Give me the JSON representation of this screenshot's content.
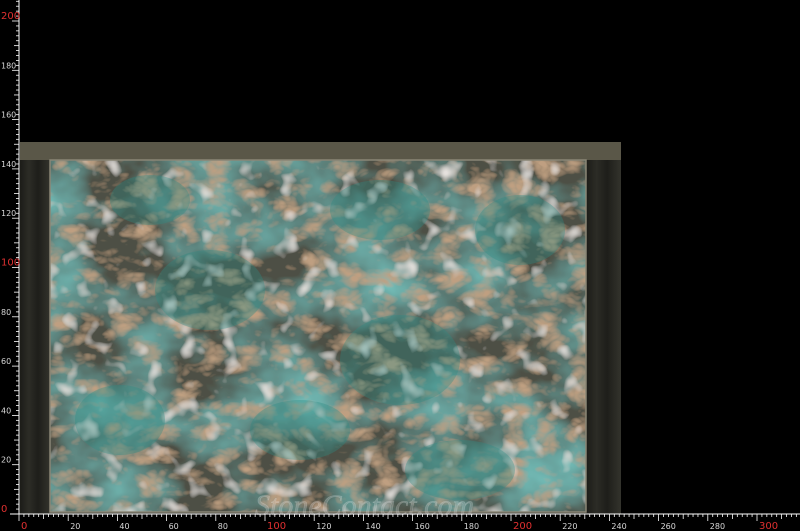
{
  "colors": {
    "background": "#000000",
    "ruler": "#ffffff",
    "tick_highlight": "#e03030",
    "stand": "#3b3a32",
    "slab_base": "#4e5146",
    "crystal": "#2f8f86",
    "vein": "#7a5538",
    "quartz": "#c9c2b8"
  },
  "ruler": {
    "x_labels": [
      "0",
      "20",
      "40",
      "60",
      "80",
      "100",
      "120",
      "140",
      "160",
      "180",
      "200",
      "220",
      "240",
      "260",
      "280",
      "300"
    ],
    "x_highlight": [
      "0",
      "100",
      "200",
      "300"
    ],
    "y_labels": [
      "0",
      "20",
      "40",
      "60",
      "80",
      "100",
      "120",
      "140",
      "160",
      "180",
      "200"
    ],
    "y_highlight": [
      "0",
      "100",
      "200"
    ]
  },
  "image": {
    "subject": "amazonite-quartzite-slab",
    "watermark": "StoneContact.com"
  }
}
